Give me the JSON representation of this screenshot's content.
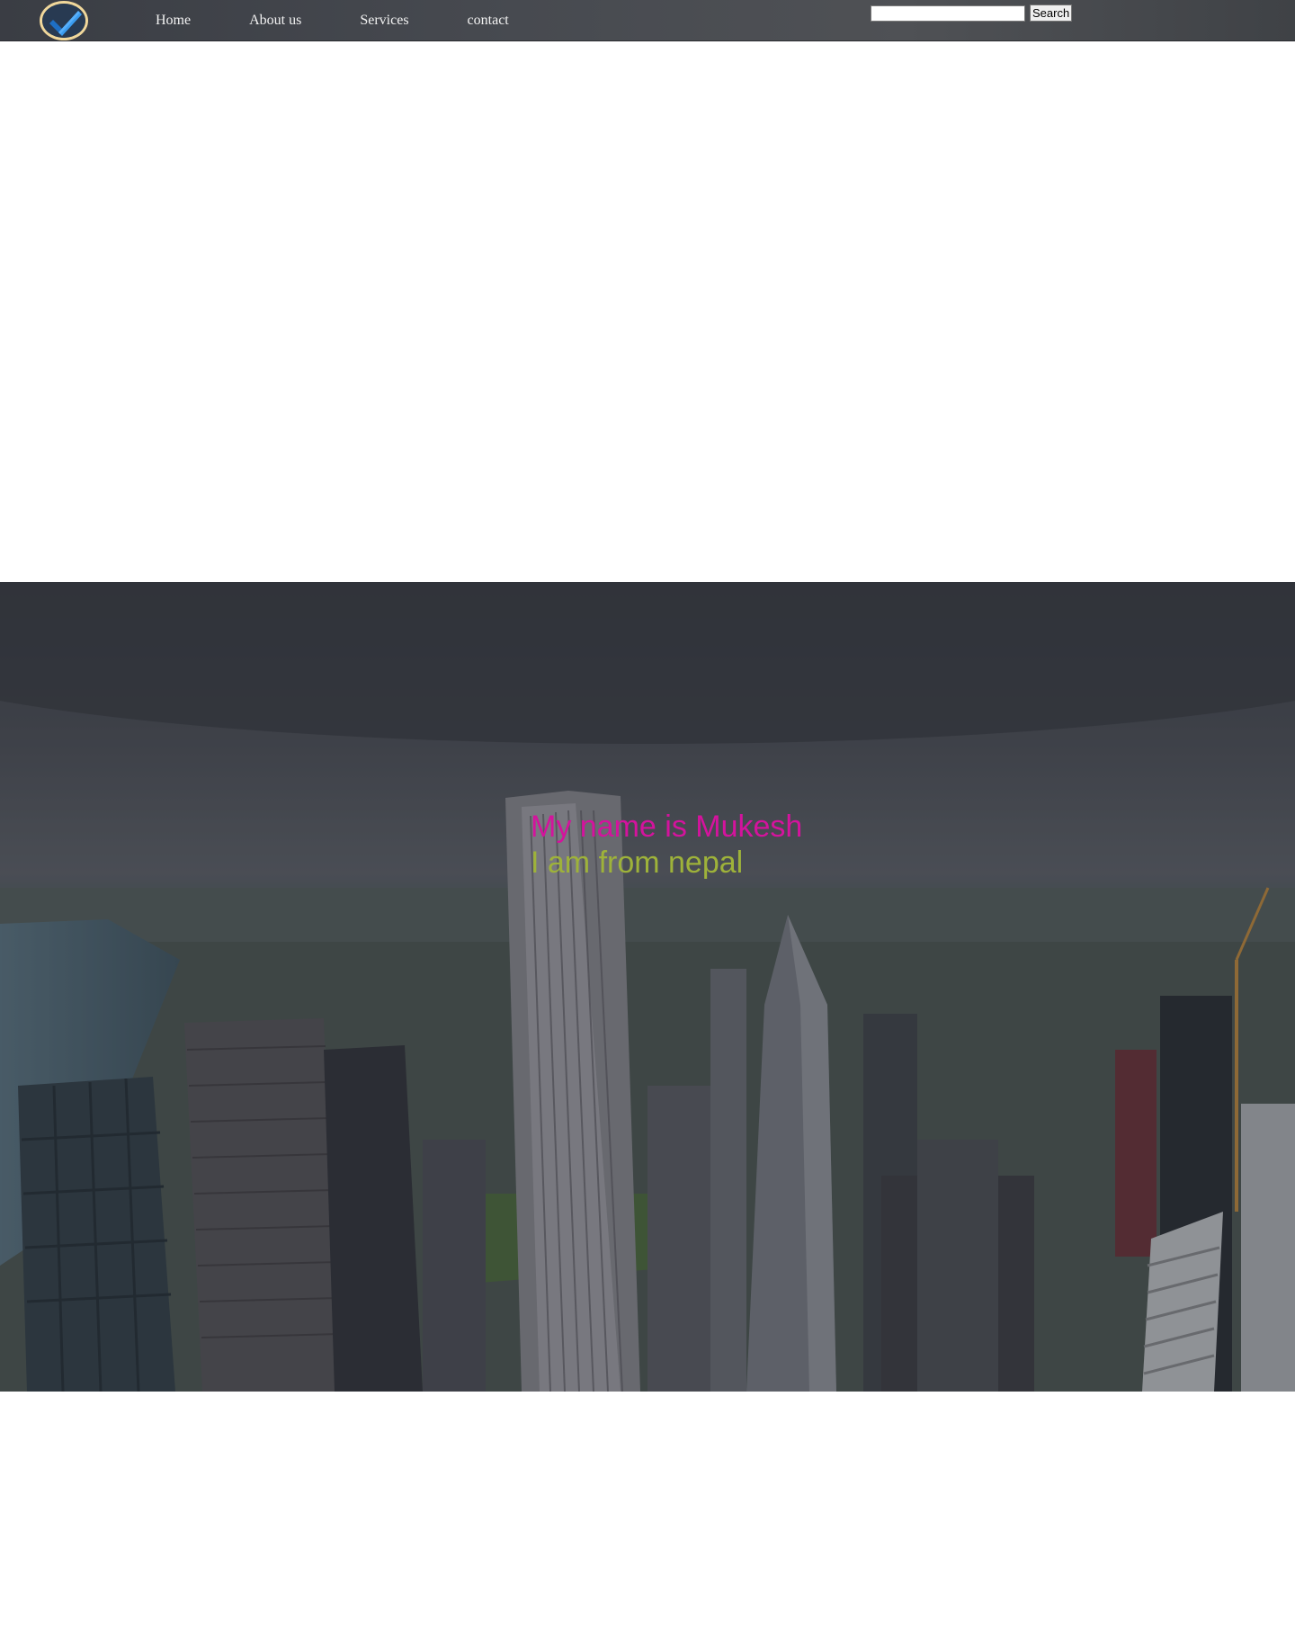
{
  "navbar": {
    "logo": {
      "icon": "checkmark-logo-icon",
      "ring_color": "#f0d79b",
      "check_color": "#2f8ee8"
    },
    "links": [
      {
        "label": "Home"
      },
      {
        "label": "About us"
      },
      {
        "label": "Services"
      },
      {
        "label": "contact"
      }
    ],
    "search": {
      "value": "",
      "placeholder": "",
      "button_label": "Search"
    }
  },
  "hero": {
    "background": "city-skyline-photo",
    "line1": "My name is Mukesh",
    "line2": "I am from nepal",
    "line1_color": "#d4139d",
    "line2_color": "#9eb23a"
  }
}
